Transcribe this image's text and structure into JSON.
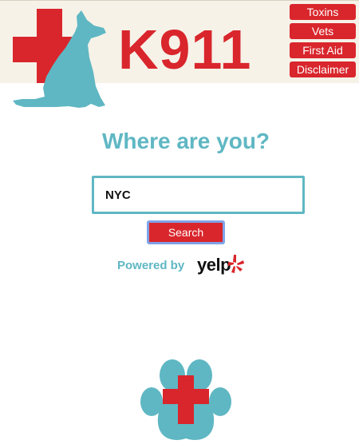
{
  "header": {
    "brand": "K911",
    "nav": [
      "Toxins",
      "Vets",
      "First Aid",
      "Disclaimer"
    ]
  },
  "main": {
    "heading": "Where are you?",
    "search": {
      "value": "NYC",
      "button_label": "Search"
    },
    "powered_by": "Powered by",
    "yelp_word": "yelp"
  },
  "colors": {
    "brand_red": "#d9262c",
    "teal": "#5fb7c3",
    "header_bg": "#f6f2e8"
  },
  "icons": [
    "medical-cross-icon",
    "dog-silhouette-icon",
    "yelp-burst-icon",
    "paw-cross-icon"
  ]
}
